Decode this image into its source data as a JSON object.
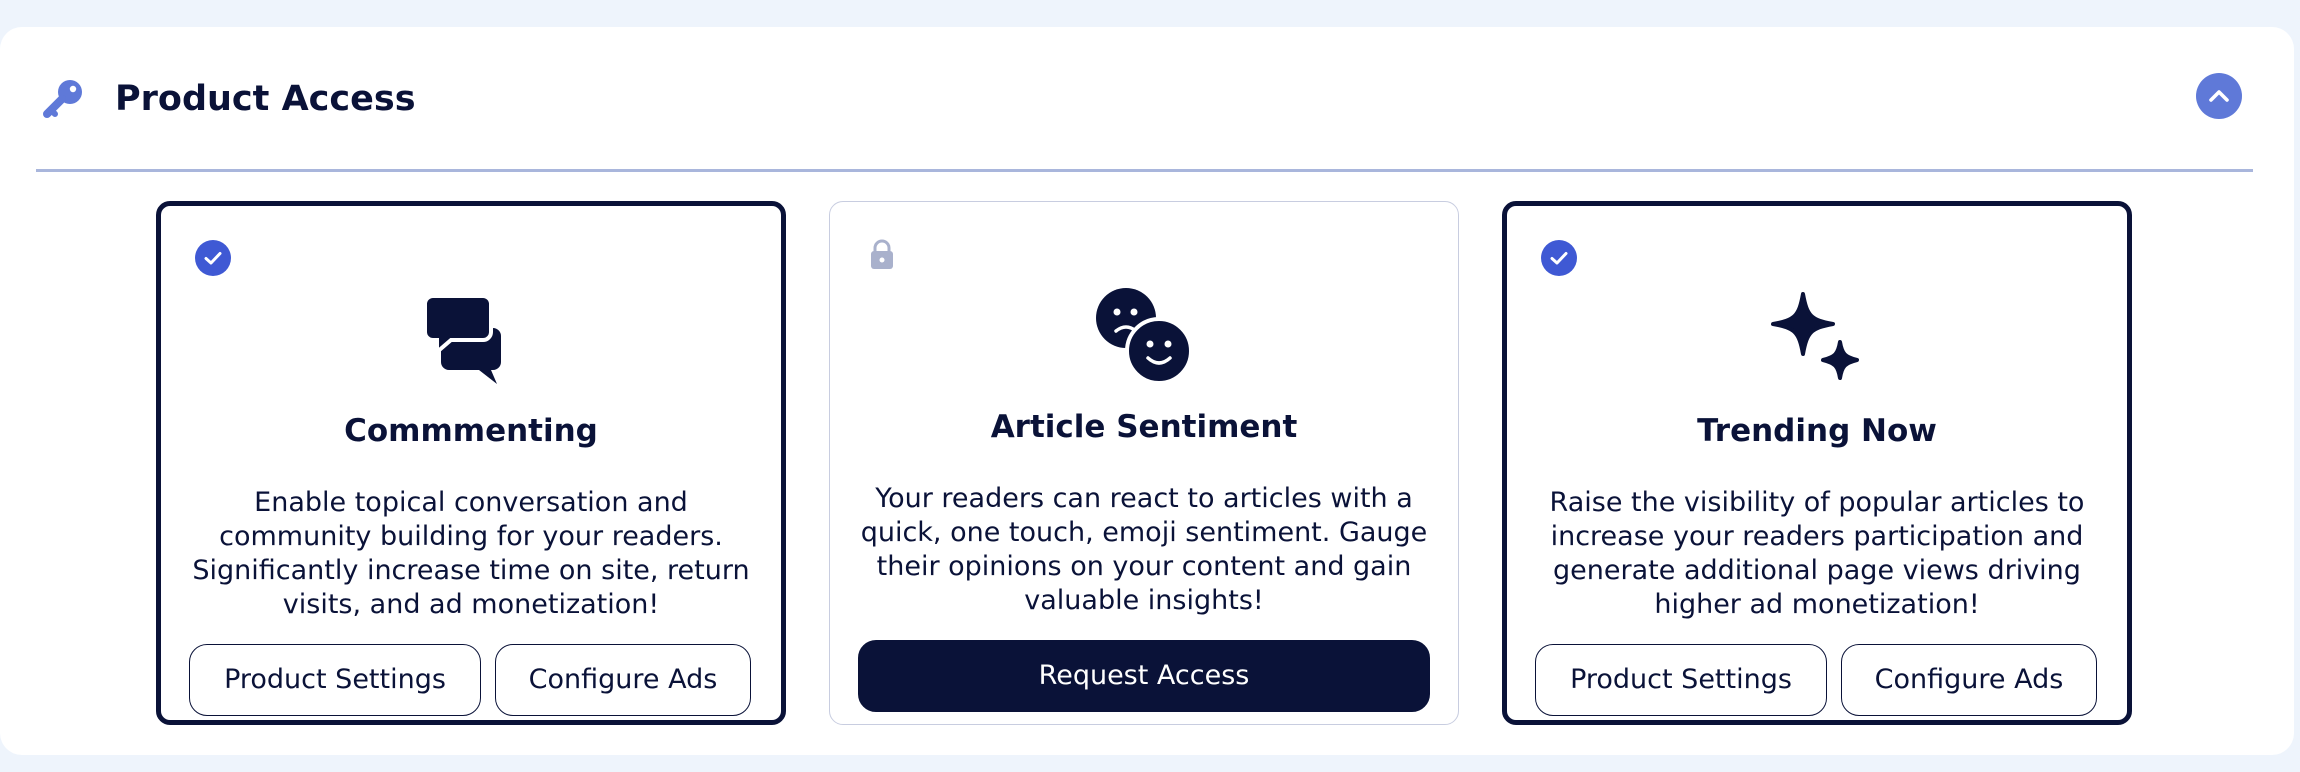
{
  "section": {
    "title": "Product Access",
    "icon": "key-icon",
    "collapse_icon": "chevron-up-icon"
  },
  "colors": {
    "navy": "#0a1238",
    "accent": "#5f79d8",
    "check": "#3f59d4",
    "lock": "#a9b1cc",
    "background": "#eef4fc"
  },
  "cards": [
    {
      "title": "Commmenting",
      "status": "enabled",
      "status_icon": "check-circle-icon",
      "icon": "chat-bubbles-icon",
      "description": "Enable topical conversation and community building for your readers. Significantly increase time on site, return visits, and ad monetization!",
      "buttons": {
        "settings": "Product Settings",
        "ads": "Configure Ads"
      }
    },
    {
      "title": "Article Sentiment",
      "status": "locked",
      "status_icon": "lock-icon",
      "icon": "emoji-faces-icon",
      "description": "Your readers can react to articles with a quick, one touch, emoji sentiment. Gauge their opinions on your content and gain valuable insights!",
      "buttons": {
        "request": "Request Access"
      }
    },
    {
      "title": "Trending Now",
      "status": "enabled",
      "status_icon": "check-circle-icon",
      "icon": "sparkles-icon",
      "description": "Raise the visibility of popular articles to increase your readers participation and generate additional page views driving higher ad monetization!",
      "buttons": {
        "settings": "Product Settings",
        "ads": "Configure Ads"
      }
    }
  ]
}
